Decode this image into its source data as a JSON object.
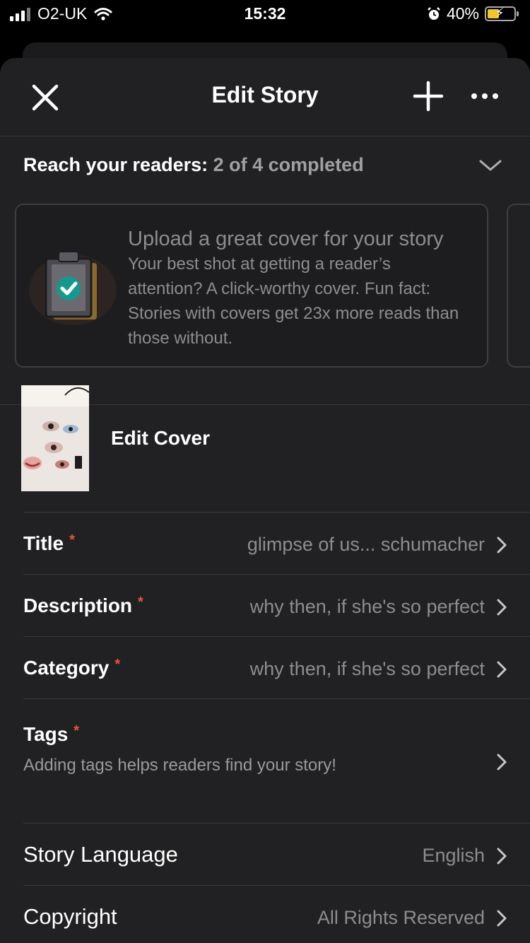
{
  "status_bar": {
    "carrier": "O2-UK",
    "time": "15:32",
    "battery": "40%",
    "icons": [
      "signal-icon",
      "wifi-icon",
      "alarm-icon",
      "battery-charging-icon"
    ]
  },
  "header": {
    "title": "Edit Story",
    "icons": [
      "close-icon",
      "plus-icon",
      "more-icon"
    ]
  },
  "progress": {
    "label": "Reach your readers:",
    "status": "2 of 4 completed"
  },
  "tip": {
    "heading": "Upload a great cover for your story",
    "body": "Your best shot at getting a reader’s attention? A click-worthy cover. Fun fact: Stories with covers get 23x more reads than those without."
  },
  "cover": {
    "label": "Edit Cover"
  },
  "fields": [
    {
      "label": "Title",
      "required": "*",
      "value": "glimpse of us... schumacher"
    },
    {
      "label": "Description",
      "required": "*",
      "value": "why then, if she's so perfect"
    },
    {
      "label": "Category",
      "required": "*",
      "value": "why then, if she's so perfect"
    },
    {
      "label": "Tags",
      "required": "*",
      "hint": "Adding tags helps readers find your story!"
    },
    {
      "label": "Story Language",
      "value": "English"
    },
    {
      "label": "Copyright",
      "value": "All Rights Reserved"
    }
  ],
  "colors": {
    "background": "#212123",
    "required": "#e8553b",
    "muted_text": "#8d8d90",
    "battery": "#f4c430"
  }
}
